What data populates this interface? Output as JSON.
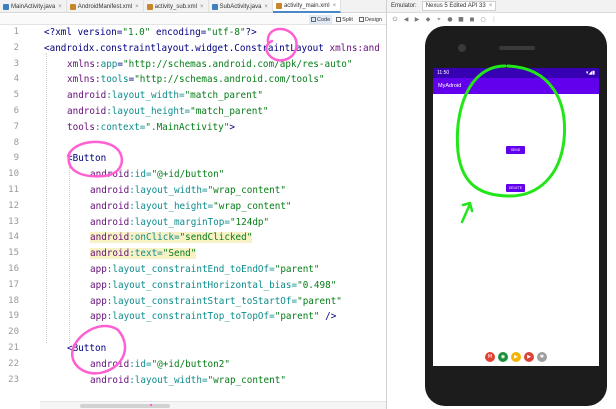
{
  "editor": {
    "tabs": [
      {
        "label": "MainActivity.java",
        "color": "#3f7fbf"
      },
      {
        "label": "AndroidManifest.xml",
        "color": "#c9852a"
      },
      {
        "label": "activity_sub.xml",
        "color": "#c9852a"
      },
      {
        "label": "SubActivity.java",
        "color": "#3f7fbf"
      },
      {
        "label": "activity_main.xml",
        "color": "#c9852a"
      }
    ],
    "view_modes": [
      "Code",
      "Split",
      "Design"
    ],
    "line_numbers": [
      "1",
      "2",
      "3",
      "4",
      "5",
      "6",
      "7",
      "8",
      "9",
      "10",
      "11",
      "12",
      "13",
      "14",
      "15",
      "16",
      "17",
      "18",
      "19",
      "20",
      "21",
      "22",
      "23"
    ],
    "lines": {
      "l1": {
        "a": "<?xml version=",
        "b": "\"1.0\"",
        "c": " encoding=",
        "d": "\"utf-8\"",
        "e": "?>"
      },
      "l2": {
        "a": "<androidx.constraintlayout.widget.ConstraintLayout",
        "b": " xmlns:and"
      },
      "l3": {
        "a": "xmlns:",
        "b": "app",
        "c": "=",
        "d": "\"http://schemas.android.com/apk/res-auto\""
      },
      "l4": {
        "a": "xmlns:",
        "b": "tools",
        "c": "=",
        "d": "\"http://schemas.android.com/tools\""
      },
      "l5": {
        "a": "android",
        "b": ":layout_width=",
        "c": "\"match_parent\""
      },
      "l6": {
        "a": "android",
        "b": ":layout_height=",
        "c": "\"match_parent\""
      },
      "l7": {
        "a": "tools",
        "b": ":context=",
        "c": "\".MainActivity\"",
        "d": ">"
      },
      "l9": {
        "a": "<Button"
      },
      "l10": {
        "a": "android",
        "b": ":id=",
        "c": "\"@+id/button\""
      },
      "l11": {
        "a": "android",
        "b": ":layout_width=",
        "c": "\"wrap_content\""
      },
      "l12": {
        "a": "android",
        "b": ":layout_height=",
        "c": "\"wrap_content\""
      },
      "l13": {
        "a": "android",
        "b": ":layout_marginTop=",
        "c": "\"124dp\""
      },
      "l14": {
        "a": "android",
        "b": ":onClick=",
        "c": "\"sendClicked\""
      },
      "l15": {
        "a": "android",
        "b": ":text=",
        "c": "\"Send\""
      },
      "l16": {
        "a": "app",
        "b": ":layout_constraintEnd_toEndOf=",
        "c": "\"parent\""
      },
      "l17": {
        "a": "app",
        "b": ":layout_constraintHorizontal_bias=",
        "c": "\"0.498\""
      },
      "l18": {
        "a": "app",
        "b": ":layout_constraintStart_toStartOf=",
        "c": "\"parent\""
      },
      "l19": {
        "a": "app",
        "b": ":layout_constraintTop_toTopOf=",
        "c": "\"parent\"",
        "d": " />"
      },
      "l21": {
        "a": "<Button"
      },
      "l22": {
        "a": "android",
        "b": ":id=",
        "c": "\"@+id/button2\""
      },
      "l23": {
        "a": "android",
        "b": ":layout_width=",
        "c": "\"wrap_content\""
      }
    }
  },
  "emulator": {
    "label": "Emulator:",
    "device": "Nexus 5 Edited API 33",
    "close_glyph": "×",
    "tool_glyphs": [
      "⏻",
      "◀",
      "▶",
      "◆",
      "⌖",
      "●",
      "■",
      "◼",
      "○",
      "⋮"
    ],
    "status_time": "11:50",
    "app_title": "MyAdroid",
    "buttons": [
      "SEND",
      "DELETE"
    ]
  },
  "colors": {
    "tag": "#000080",
    "attr_ns": "#660e7a",
    "attr_name": "#0e8c8c",
    "value": "#067d17",
    "highlight": "#f7f1c6",
    "annotation_pink": "#ff5fd2",
    "annotation_green": "#23e619",
    "app_primary": "#6200ee"
  }
}
